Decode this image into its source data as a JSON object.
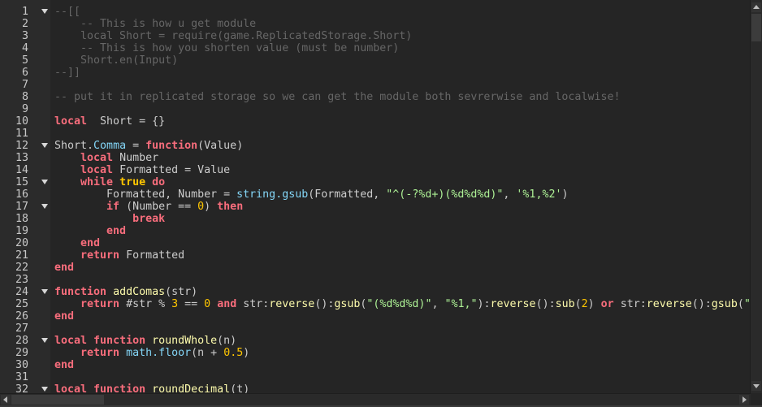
{
  "editor": {
    "colors": {
      "background": "#252525",
      "keyword": "#f86d7c",
      "function": "#fdfbac",
      "builtin": "#84d6f7",
      "number": "#ffc600",
      "string": "#adf195",
      "comment": "#666666",
      "text": "#cccccc"
    },
    "lines": [
      {
        "n": "1",
        "fold": true,
        "t": [
          [
            "cm",
            "--[["
          ]
        ]
      },
      {
        "n": "2",
        "t": [
          [
            "cm",
            "    -- This is how u get module"
          ]
        ]
      },
      {
        "n": "3",
        "t": [
          [
            "cm",
            "    local Short = require(game.ReplicatedStorage.Short)"
          ]
        ]
      },
      {
        "n": "4",
        "t": [
          [
            "cm",
            "    -- This is how you shorten value (must be number)"
          ]
        ]
      },
      {
        "n": "5",
        "t": [
          [
            "cm",
            "    Short.en(Input)"
          ]
        ]
      },
      {
        "n": "6",
        "t": [
          [
            "cm",
            "--]]"
          ]
        ]
      },
      {
        "n": "7",
        "t": []
      },
      {
        "n": "8",
        "t": [
          [
            "cm",
            "-- put it in replicated storage so we can get the module both sevrerwise and localwise!"
          ]
        ]
      },
      {
        "n": "9",
        "t": []
      },
      {
        "n": "10",
        "t": [
          [
            "kw",
            "local"
          ],
          [
            "",
            "  Short = {}"
          ]
        ]
      },
      {
        "n": "11",
        "t": []
      },
      {
        "n": "12",
        "fold": true,
        "t": [
          [
            "",
            "Short."
          ],
          [
            "bi",
            "Comma"
          ],
          [
            "",
            " = "
          ],
          [
            "kw",
            "function"
          ],
          [
            "",
            "(Value)"
          ]
        ]
      },
      {
        "n": "13",
        "t": [
          [
            "",
            "    "
          ],
          [
            "kw",
            "local"
          ],
          [
            "",
            " Number"
          ]
        ]
      },
      {
        "n": "14",
        "t": [
          [
            "",
            "    "
          ],
          [
            "kw",
            "local"
          ],
          [
            "",
            " Formatted = Value"
          ]
        ]
      },
      {
        "n": "15",
        "fold": true,
        "t": [
          [
            "",
            "    "
          ],
          [
            "kw",
            "while"
          ],
          [
            "",
            " "
          ],
          [
            "bool",
            "true"
          ],
          [
            "",
            " "
          ],
          [
            "kw",
            "do"
          ]
        ]
      },
      {
        "n": "16",
        "t": [
          [
            "",
            "        Formatted, Number = "
          ],
          [
            "bi",
            "string.gsub"
          ],
          [
            "",
            "(Formatted, "
          ],
          [
            "str",
            "\"^(-?%d+)(%d%d%d)\""
          ],
          [
            "",
            ", "
          ],
          [
            "str",
            "'%1,%2'"
          ],
          [
            "",
            ")"
          ]
        ]
      },
      {
        "n": "17",
        "fold": true,
        "t": [
          [
            "",
            "        "
          ],
          [
            "kw",
            "if"
          ],
          [
            "",
            " (Number == "
          ],
          [
            "num",
            "0"
          ],
          [
            "",
            ") "
          ],
          [
            "kw",
            "then"
          ]
        ]
      },
      {
        "n": "18",
        "t": [
          [
            "",
            "            "
          ],
          [
            "kw",
            "break"
          ]
        ]
      },
      {
        "n": "19",
        "t": [
          [
            "",
            "        "
          ],
          [
            "kw",
            "end"
          ]
        ]
      },
      {
        "n": "20",
        "t": [
          [
            "",
            "    "
          ],
          [
            "kw",
            "end"
          ]
        ]
      },
      {
        "n": "21",
        "t": [
          [
            "",
            "    "
          ],
          [
            "kw",
            "return"
          ],
          [
            "",
            " Formatted"
          ]
        ]
      },
      {
        "n": "22",
        "t": [
          [
            "kw",
            "end"
          ]
        ]
      },
      {
        "n": "23",
        "t": []
      },
      {
        "n": "24",
        "fold": true,
        "t": [
          [
            "kw",
            "function"
          ],
          [
            "",
            " "
          ],
          [
            "fn",
            "addComas"
          ],
          [
            "",
            "(str)"
          ]
        ]
      },
      {
        "n": "25",
        "t": [
          [
            "",
            "    "
          ],
          [
            "kw",
            "return"
          ],
          [
            "",
            " #str % "
          ],
          [
            "num",
            "3"
          ],
          [
            "",
            " == "
          ],
          [
            "num",
            "0"
          ],
          [
            "",
            " "
          ],
          [
            "kw",
            "and"
          ],
          [
            "",
            " str:"
          ],
          [
            "fn",
            "reverse"
          ],
          [
            "",
            "():"
          ],
          [
            "fn",
            "gsub"
          ],
          [
            "",
            "("
          ],
          [
            "str",
            "\"(%d%d%d)\""
          ],
          [
            "",
            ", "
          ],
          [
            "str",
            "\"%1,\""
          ],
          [
            "",
            "):"
          ],
          [
            "fn",
            "reverse"
          ],
          [
            "",
            "():"
          ],
          [
            "fn",
            "sub"
          ],
          [
            "",
            "("
          ],
          [
            "num",
            "2"
          ],
          [
            "",
            ") "
          ],
          [
            "kw",
            "or"
          ],
          [
            "",
            " str:"
          ],
          [
            "fn",
            "reverse"
          ],
          [
            "",
            "():"
          ],
          [
            "fn",
            "gsub"
          ],
          [
            "",
            "("
          ],
          [
            "str",
            "\""
          ]
        ]
      },
      {
        "n": "26",
        "t": [
          [
            "kw",
            "end"
          ]
        ]
      },
      {
        "n": "27",
        "t": []
      },
      {
        "n": "28",
        "fold": true,
        "t": [
          [
            "kw",
            "local"
          ],
          [
            "",
            " "
          ],
          [
            "kw",
            "function"
          ],
          [
            "",
            " "
          ],
          [
            "fn",
            "roundWhole"
          ],
          [
            "",
            "(n)"
          ]
        ]
      },
      {
        "n": "29",
        "t": [
          [
            "",
            "    "
          ],
          [
            "kw",
            "return"
          ],
          [
            "",
            " "
          ],
          [
            "bi",
            "math.floor"
          ],
          [
            "",
            "(n + "
          ],
          [
            "num",
            "0.5"
          ],
          [
            "",
            ")"
          ]
        ]
      },
      {
        "n": "30",
        "t": [
          [
            "kw",
            "end"
          ]
        ]
      },
      {
        "n": "31",
        "t": []
      },
      {
        "n": "32",
        "fold": true,
        "t": [
          [
            "kw",
            "local"
          ],
          [
            "",
            " "
          ],
          [
            "kw",
            "function"
          ],
          [
            "",
            " "
          ],
          [
            "fn",
            "roundDecimal"
          ],
          [
            "",
            "(t)"
          ]
        ]
      }
    ]
  }
}
